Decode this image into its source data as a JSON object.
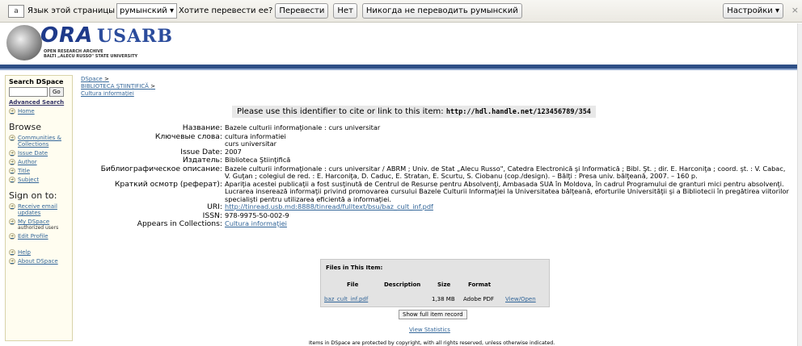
{
  "translate_bar": {
    "icon_glyph": "a",
    "lead_text": "Язык этой страницы",
    "language": "румынский",
    "question": "Хотите перевести ее?",
    "translate_label": "Перевести",
    "no_label": "Нет",
    "never_label": "Никогда не переводить румынский",
    "settings_label": "Настройки",
    "close_glyph": "×"
  },
  "header": {
    "logo_text_1": "ORA",
    "logo_text_2": "USARB",
    "logo_sub_1": "OPEN RESEARCH ARCHIVE",
    "logo_sub_2": "BALTI „ALECU RUSSO\" STATE UNIVERSITY"
  },
  "sidebar": {
    "search_title": "Search DSpace",
    "go_label": "Go",
    "advanced_label": "Advanced Search",
    "home_label": "Home",
    "browse_heading": "Browse",
    "browse_items": [
      "Communities & Collections",
      "Issue Date",
      "Author",
      "Title",
      "Subject"
    ],
    "signon_heading": "Sign on to:",
    "signon_items": [
      "Receive email updates",
      "My DSpace",
      "Edit Profile"
    ],
    "authorized_note": "authorized users",
    "help_items": [
      "Help",
      "About DSpace"
    ]
  },
  "breadcrumb": {
    "items": [
      "DSpace",
      "BIBLIOTECA ŞTIINŢIFICĂ",
      "Cultura informaţiei"
    ],
    "sep": ">"
  },
  "identifier": {
    "text": "Please use this identifier to cite or link to this item:",
    "handle": "http://hdl.handle.net/123456789/354"
  },
  "metadata": {
    "title_label": "Название:",
    "title_value": "Bazele culturii informaţionale : curs universitar",
    "keywords_label": "Ключевые слова:",
    "keyword_1": "cultura informatiei",
    "keyword_2": "curs universitar",
    "date_label": "Issue Date:",
    "date_value": "2007",
    "publisher_label": "Издатель:",
    "publisher_value": "Biblioteca Ştiinţifică",
    "citation_label": "Библиографическое описание:",
    "citation_value": "Bazele culturii informaţionale : curs universitar / ABRM ; Univ. de Stat „Alecu Russo\", Catedra Electronică şi Informatică ; Bibl. Şt. ; dir. E. Harconiţa ; coord. şt. : V. Cabac, V. Guţan ; colegiul de red. : E. Harconiţa, D. Caduc, E. Stratan, E. Scurtu, S. Ciobanu (cop./design). – Bălţi : Presa univ. bălţeană, 2007. – 160 p.",
    "abstract_label": "Краткий осмотр (реферат):",
    "abstract_value": "Apariţia acestei publicaţii a fost susţinută de Centrul de Resurse pentru Absolvenţi, Ambasada SUA în Moldova, în cadrul Programului de granturi mici pentru absolvenţi. Lucrarea inserează informaţii privind promovarea cursului Bazele Culturii Informaţiei la Universitatea bălţeană, eforturile Universităţii şi a Bibliotecii în pregătirea viitorilor specialişti pentru utilizarea eficientă a informaţiei.",
    "uri_label": "URI:",
    "uri_value": "http://tinread.usb.md:8888/tinread/fulltext/bsu/baz_cult_inf.pdf",
    "issn_label": "ISSN:",
    "issn_value": "978-9975-50-002-9",
    "collections_label": "Appears in Collections:",
    "collections_value": "Cultura informaţiei"
  },
  "files": {
    "title": "Files in This Item:",
    "headers": [
      "File",
      "Description",
      "Size",
      "Format"
    ],
    "file_name": "baz_cult_inf.pdf",
    "file_desc": "",
    "file_size": "1,38 MB",
    "file_format": "Adobe PDF",
    "file_action": "View/Open"
  },
  "actions": {
    "show_full": "Show full item record",
    "view_stats": "View Statistics"
  },
  "footer": {
    "copyright": "Items in DSpace are protected by copyright, with all rights reserved, unless otherwise indicated."
  }
}
